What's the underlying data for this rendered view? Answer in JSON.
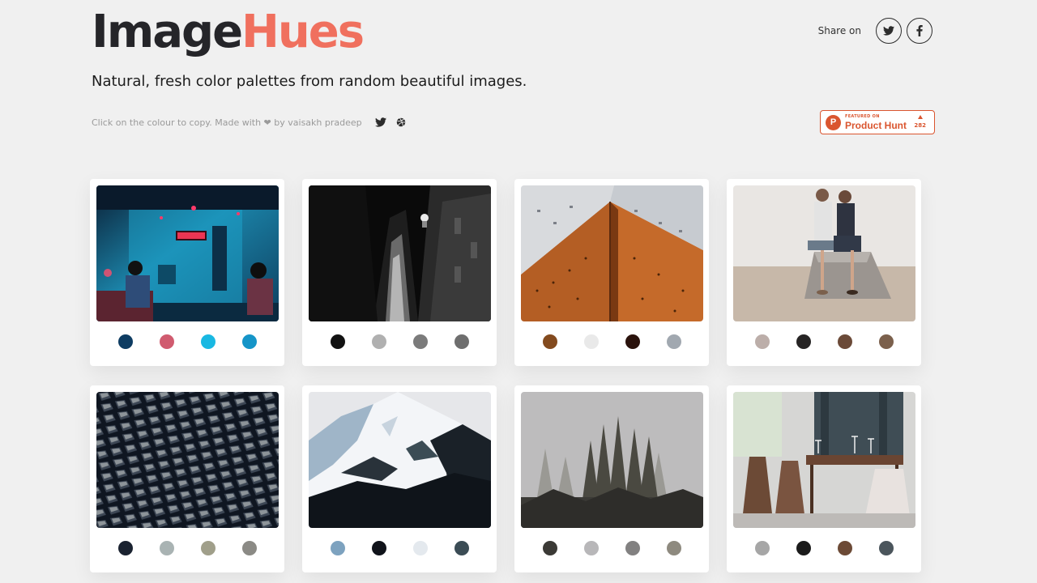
{
  "header": {
    "logo_part1": "Image",
    "logo_part2": "Hues",
    "tagline": "Natural, fresh color palettes from random beautiful images.",
    "credit": "Click on the colour to copy. Made with ❤ by vaisakh pradeep",
    "share_label": "Share on"
  },
  "product_hunt": {
    "featured": "FEATURED ON",
    "name": "Product Hunt",
    "votes": "282"
  },
  "colors": {
    "accent": "#f0705e",
    "ph_orange": "#da552f"
  },
  "icons": [
    "twitter-icon",
    "facebook-icon",
    "dribbble-icon",
    "product-hunt-logo"
  ],
  "cards": [
    {
      "scene": "neon-bar",
      "palette": [
        "#0e3c62",
        "#d05b6f",
        "#19b8e2",
        "#1595c8"
      ]
    },
    {
      "scene": "dark-alley",
      "palette": [
        "#121212",
        "#b0b0b0",
        "#7b7b7b",
        "#6e6e6e"
      ]
    },
    {
      "scene": "brick-building",
      "palette": [
        "#834a1e",
        "#e9e9e9",
        "#2a120c",
        "#a1a8b0"
      ]
    },
    {
      "scene": "couple-seated",
      "palette": [
        "#bcaea9",
        "#262424",
        "#6b4a38",
        "#7b604c"
      ]
    },
    {
      "scene": "honeycomb-facade",
      "palette": [
        "#1a2230",
        "#a9b3b3",
        "#a09f8a",
        "#8b8a85"
      ]
    },
    {
      "scene": "snowy-mountain",
      "palette": [
        "#7da2bf",
        "#10131a",
        "#e4e9ee",
        "#3b4c55"
      ]
    },
    {
      "scene": "foggy-forest",
      "palette": [
        "#3b3a36",
        "#b8b7b9",
        "#828181",
        "#8e8a7f"
      ]
    },
    {
      "scene": "restaurant",
      "palette": [
        "#a6a6a6",
        "#1b1b1b",
        "#6c4a36",
        "#4b555c"
      ]
    }
  ]
}
